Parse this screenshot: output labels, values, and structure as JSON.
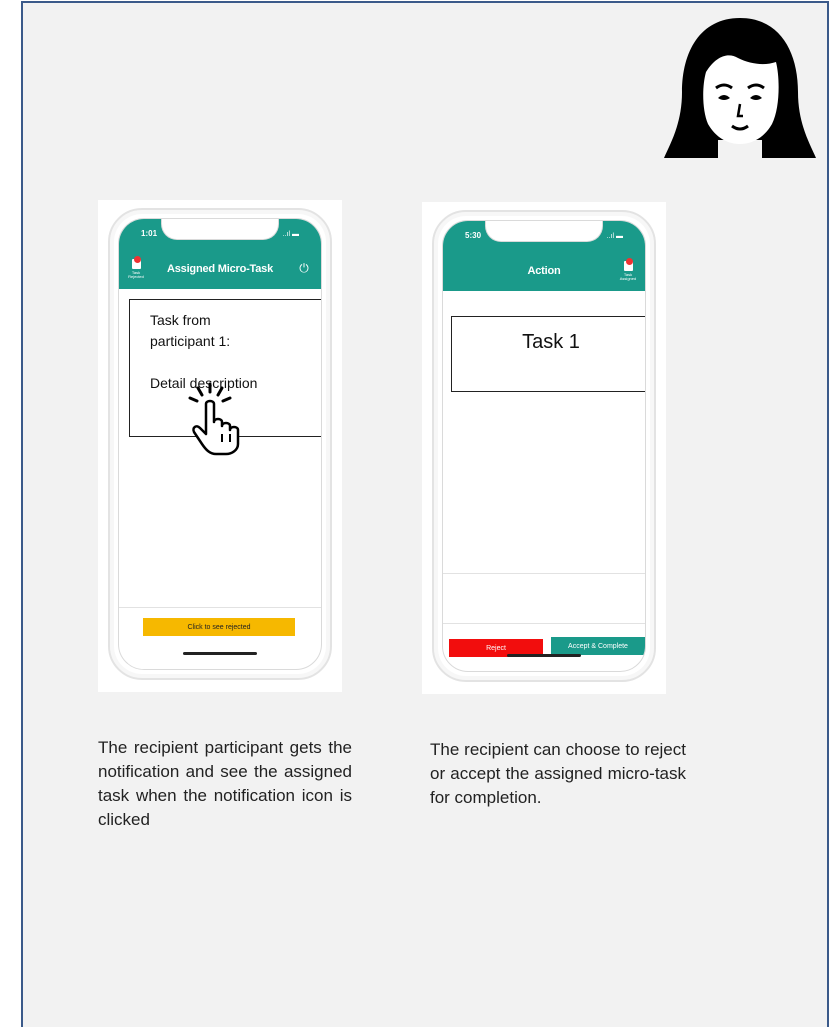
{
  "phone1": {
    "time": "1:01",
    "signal": "..ıl ▬",
    "title": "Assigned Micro-Task",
    "left_icon_label": "Task Rejected",
    "task_lines": [
      "Task from",
      "participant 1:",
      "Detail description"
    ],
    "bottom_button": "Click to see rejected"
  },
  "phone2": {
    "time": "5:30",
    "signal": "..ıl ▬",
    "title": "Action",
    "right_icon_label": "Task Assigned",
    "task_title": "Task 1",
    "reject_button": "Reject",
    "accept_button": "Accept & Complete"
  },
  "captions": {
    "left": "The recipient participant gets the notification and see the assigned task when the notification icon is clicked",
    "right": "The recipient can choose to reject or accept the assigned micro-task for completion."
  },
  "colors": {
    "teal": "#1a9a8a",
    "yellow": "#f6b800",
    "red": "#f20d0d",
    "border_blue": "#3b5a8a"
  },
  "icons": [
    "woman-avatar-icon",
    "pointing-hand-icon",
    "power-icon",
    "document-icon"
  ]
}
